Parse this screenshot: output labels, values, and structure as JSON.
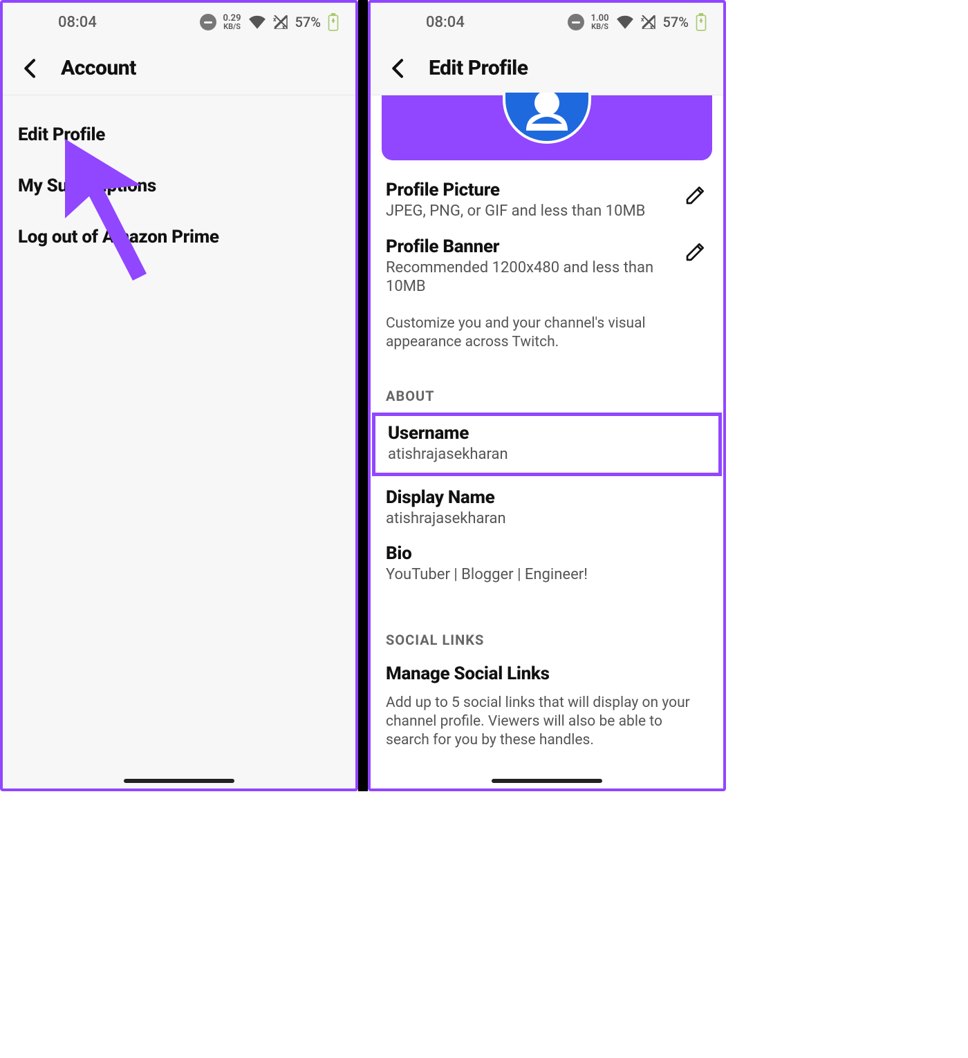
{
  "left": {
    "status": {
      "time": "08:04",
      "rate": "0.29",
      "rate_unit": "KB/S",
      "battery": "57%"
    },
    "title": "Account",
    "menu": {
      "edit_profile": "Edit Profile",
      "my_subscriptions": "My Subscriptions",
      "logout_prime": "Log out of Amazon Prime"
    }
  },
  "right": {
    "status": {
      "time": "08:04",
      "rate": "1.00",
      "rate_unit": "KB/S",
      "battery": "57%"
    },
    "title": "Edit Profile",
    "profile_picture": {
      "title": "Profile Picture",
      "sub": "JPEG, PNG, or GIF and less than 10MB"
    },
    "profile_banner": {
      "title": "Profile Banner",
      "sub": "Recommended 1200x480 and less than 10MB"
    },
    "appearance_desc": "Customize you and your channel's visual appearance across Twitch.",
    "about_label": "ABOUT",
    "username": {
      "title": "Username",
      "value": "atishrajasekharan"
    },
    "display_name": {
      "title": "Display Name",
      "value": "atishrajasekharan"
    },
    "bio": {
      "title": "Bio",
      "value": "YouTuber | Blogger | Engineer!"
    },
    "social_label": "SOCIAL LINKS",
    "social": {
      "title": "Manage Social Links",
      "desc": "Add up to 5 social links that will display on your channel profile. Viewers will also be able to search for you by these handles."
    }
  }
}
